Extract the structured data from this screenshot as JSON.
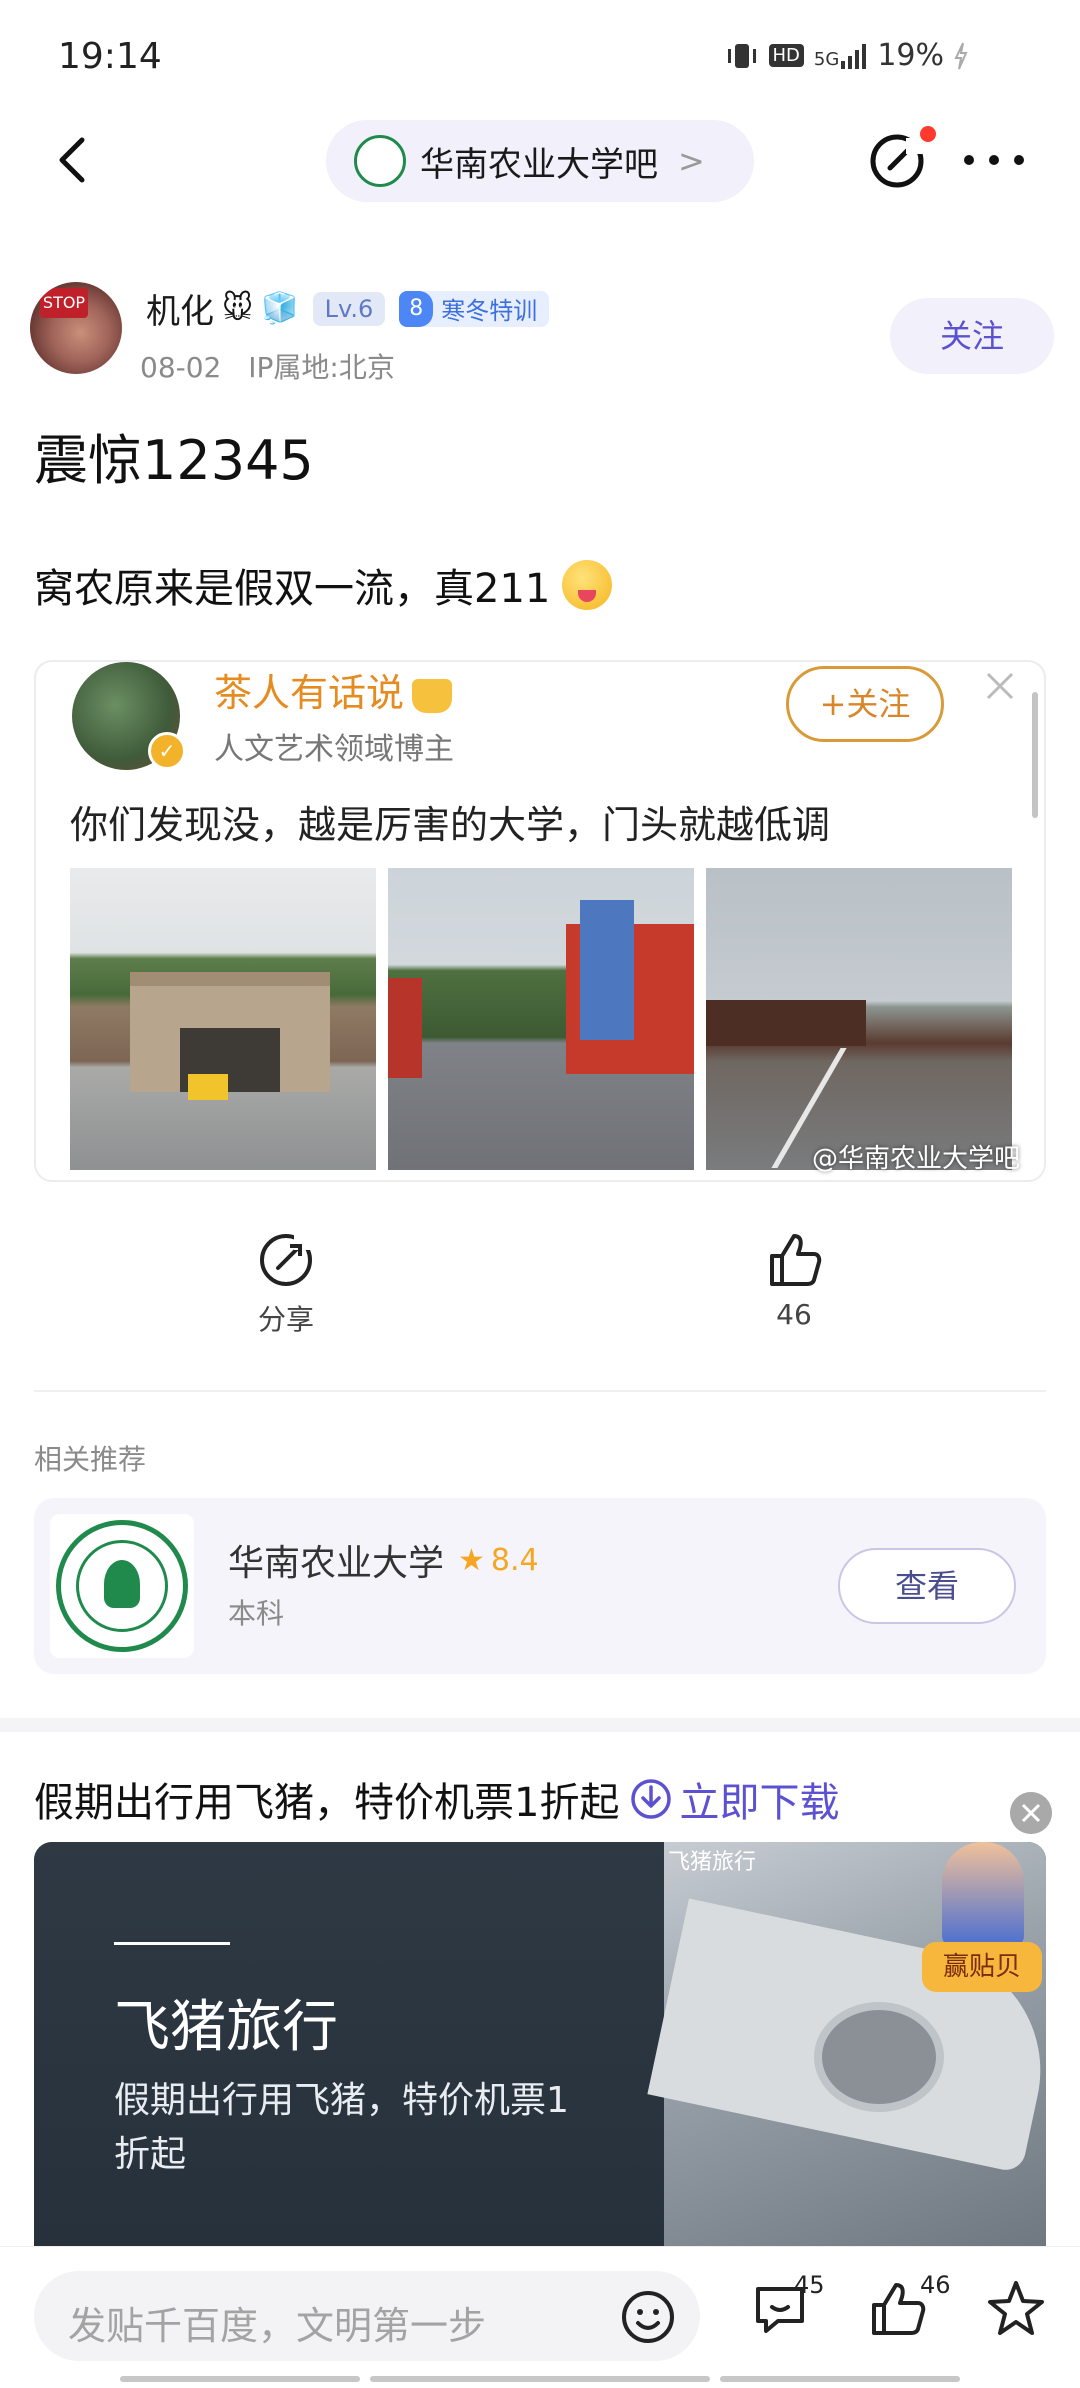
{
  "status_bar": {
    "time": "19:14",
    "network": "5G",
    "hd": "HD",
    "battery": "19%"
  },
  "nav": {
    "forum_name": "华南农业大学吧",
    "forum_arrow": ">"
  },
  "author": {
    "name": "机化",
    "emojis": [
      "🐭",
      "🧊"
    ],
    "level": "Lv.6",
    "vip_level": "8",
    "vip_label": "寒冬特训",
    "date": "08-02",
    "ip_location": "IP属地:北京",
    "follow_label": "关注"
  },
  "post": {
    "title": "震惊12345",
    "body": "窝农原来是假双一流，真211"
  },
  "embed": {
    "name": "茶人有话说",
    "subtitle": "人文艺术领域博主",
    "follow_label": "+关注",
    "text": "你们发现没，越是厉害的大学，门头就越低调",
    "watermark": "@华南农业大学吧"
  },
  "actions": {
    "share_label": "分享",
    "like_count": "46"
  },
  "related": {
    "heading": "相关推荐",
    "name": "华南农业大学",
    "rating": "8.4",
    "type": "本科",
    "view_label": "查看"
  },
  "ad": {
    "title": "假期出行用飞猪，特价机票1折起",
    "cta": "立即下载",
    "brand": "飞猪旅行",
    "desc": "假期出行用飞猪，特价机票1折起",
    "tag": "飞猪旅行",
    "badge": "赢贴贝"
  },
  "bottom_bar": {
    "placeholder": "发贴千百度，文明第一步",
    "comment_count": "45",
    "like_count": "46"
  },
  "colors": {
    "accent": "#5b51d1",
    "follow_bg": "#f1f0fb",
    "orange": "#e58b1f"
  }
}
